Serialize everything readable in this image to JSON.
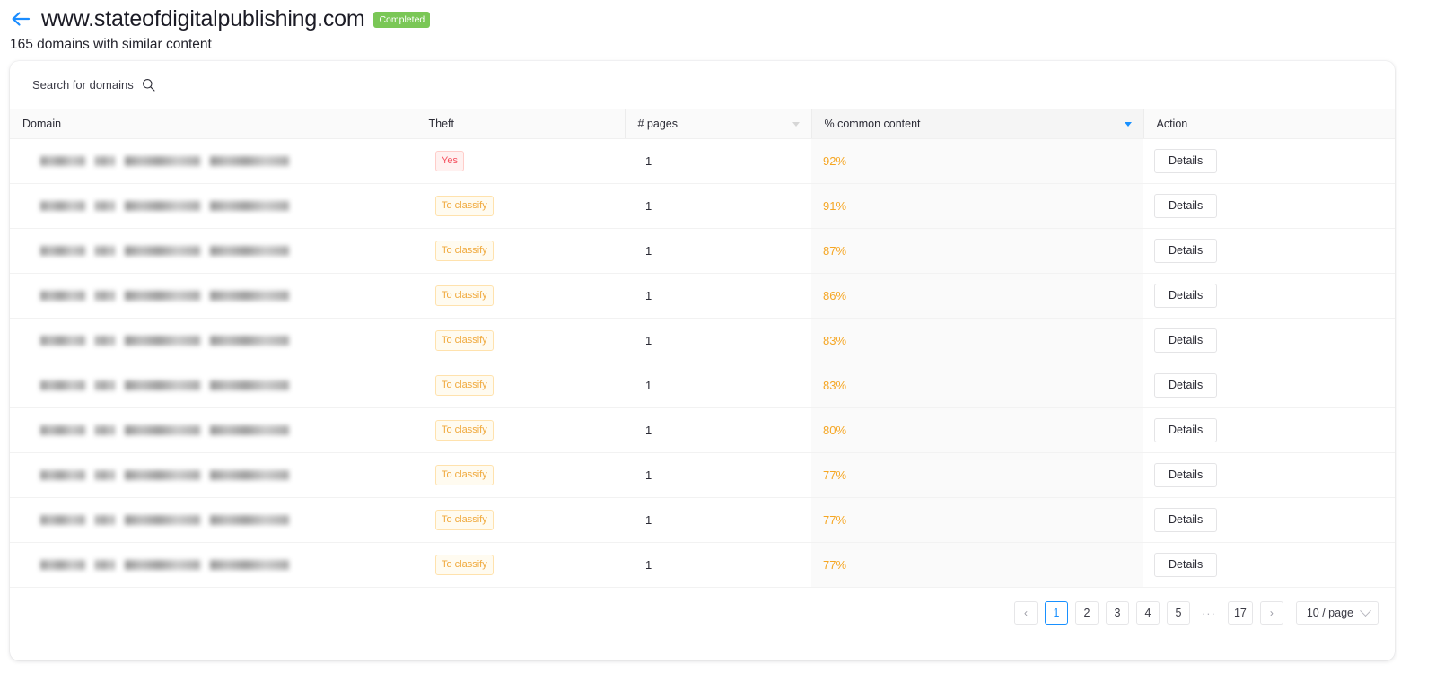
{
  "header": {
    "back_icon": "arrow-left-icon",
    "title": "www.stateofdigitalpublishing.com",
    "status": "Completed",
    "subtitle": "165 domains with similar content",
    "accent_green": "#7ac756",
    "accent_blue": "#1890ff"
  },
  "search": {
    "placeholder": "Search for domains",
    "icon": "search-icon"
  },
  "table": {
    "columns": [
      {
        "key": "domain",
        "label": "Domain",
        "sortable": false
      },
      {
        "key": "theft",
        "label": "Theft",
        "sortable": false
      },
      {
        "key": "pages",
        "label": "# pages",
        "sortable": true,
        "sort_state": "inactive"
      },
      {
        "key": "common",
        "label": "% common content",
        "sortable": true,
        "sort_state": "desc"
      },
      {
        "key": "action",
        "label": "Action",
        "sortable": false
      }
    ],
    "rows": [
      {
        "domain": "",
        "theft": "Yes",
        "theft_type": "yes",
        "pages": "1",
        "common": "92%",
        "action": "Details"
      },
      {
        "domain": "",
        "theft": "To classify",
        "theft_type": "toclassify",
        "pages": "1",
        "common": "91%",
        "action": "Details"
      },
      {
        "domain": "",
        "theft": "To classify",
        "theft_type": "toclassify",
        "pages": "1",
        "common": "87%",
        "action": "Details"
      },
      {
        "domain": "",
        "theft": "To classify",
        "theft_type": "toclassify",
        "pages": "1",
        "common": "86%",
        "action": "Details"
      },
      {
        "domain": "",
        "theft": "To classify",
        "theft_type": "toclassify",
        "pages": "1",
        "common": "83%",
        "action": "Details"
      },
      {
        "domain": "",
        "theft": "To classify",
        "theft_type": "toclassify",
        "pages": "1",
        "common": "83%",
        "action": "Details"
      },
      {
        "domain": "",
        "theft": "To classify",
        "theft_type": "toclassify",
        "pages": "1",
        "common": "80%",
        "action": "Details"
      },
      {
        "domain": "",
        "theft": "To classify",
        "theft_type": "toclassify",
        "pages": "1",
        "common": "77%",
        "action": "Details"
      },
      {
        "domain": "",
        "theft": "To classify",
        "theft_type": "toclassify",
        "pages": "1",
        "common": "77%",
        "action": "Details"
      },
      {
        "domain": "",
        "theft": "To classify",
        "theft_type": "toclassify",
        "pages": "1",
        "common": "77%",
        "action": "Details"
      }
    ]
  },
  "pagination": {
    "prev": "‹",
    "next": "›",
    "pages": [
      "1",
      "2",
      "3",
      "4",
      "5"
    ],
    "ellipsis": "···",
    "last_page": "17",
    "current_page": "1",
    "page_size": "10 / page"
  }
}
